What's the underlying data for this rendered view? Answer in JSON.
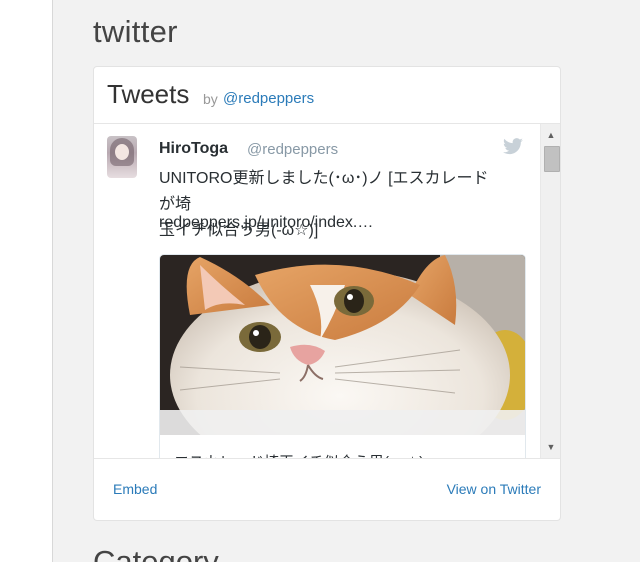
{
  "sidebar": {
    "section_title": "twitter",
    "next_section_title": "Category"
  },
  "widget": {
    "title": "Tweets",
    "by_label": "by",
    "handle": "@redpeppers",
    "tweet": {
      "author_name": "HiroToga",
      "author_handle": "@redpeppers",
      "text": "UNITORO更新しました(･ω･)ノ [エスカレードが埼\n玉イチ似合う男(-ω☆)]",
      "link": "redpeppers.jp/unitoro/index.…",
      "card_title": "エスカレード埼玉イチ似合う男(-ω☆)"
    },
    "footer": {
      "embed_label": "Embed",
      "view_label": "View on Twitter"
    }
  },
  "icons": {
    "bird": "twitter-bird-icon",
    "scroll_up": "arrow-up-icon",
    "scroll_down": "arrow-down-icon"
  },
  "colors": {
    "link": "#2b7bb9",
    "bird": "#c8d1d8",
    "sidebar_bg": "#f2f2f2"
  }
}
